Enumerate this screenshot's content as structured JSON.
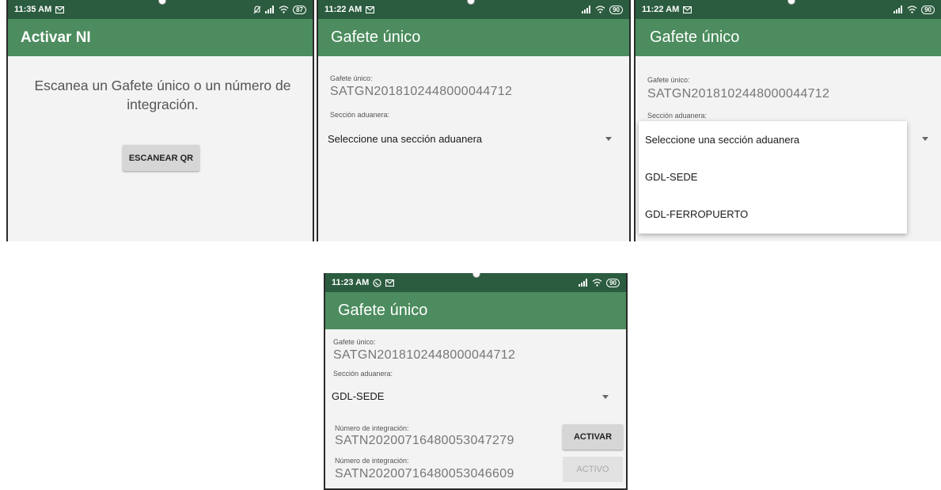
{
  "screen1": {
    "time": "11:35 AM",
    "battery": "87",
    "title": "Activar NI",
    "prompt": "Escanea un Gafete único o un número de integración.",
    "scan_button": "ESCANEAR QR"
  },
  "screen2": {
    "time": "11:22 AM",
    "battery": "90",
    "title": "Gafete único",
    "gafete_label": "Gafete único:",
    "gafete_value": "SATGN2018102448000044712",
    "seccion_label": "Sección aduanera:",
    "seccion_value": "Seleccione una sección aduanera"
  },
  "screen3": {
    "time": "11:22 AM",
    "battery": "90",
    "title": "Gafete único",
    "gafete_label": "Gafete único:",
    "gafete_value": "SATGN2018102448000044712",
    "seccion_label": "Sección aduanera:",
    "options": [
      "Seleccione una sección aduanera",
      "GDL-SEDE",
      "GDL-FERROPUERTO"
    ]
  },
  "screen4": {
    "time": "11:23 AM",
    "battery": "90",
    "title": "Gafete único",
    "gafete_label": "Gafete único:",
    "gafete_value": "SATGN2018102448000044712",
    "seccion_label": "Sección aduanera:",
    "seccion_value": "GDL-SEDE",
    "ni_rows": [
      {
        "label": "Número de integración:",
        "value": "SATN20200716480053047279",
        "button": "ACTIVAR"
      },
      {
        "label": "Número de integración:",
        "value": "SATN20200716480053046609",
        "button": "ACTIVO"
      }
    ]
  }
}
